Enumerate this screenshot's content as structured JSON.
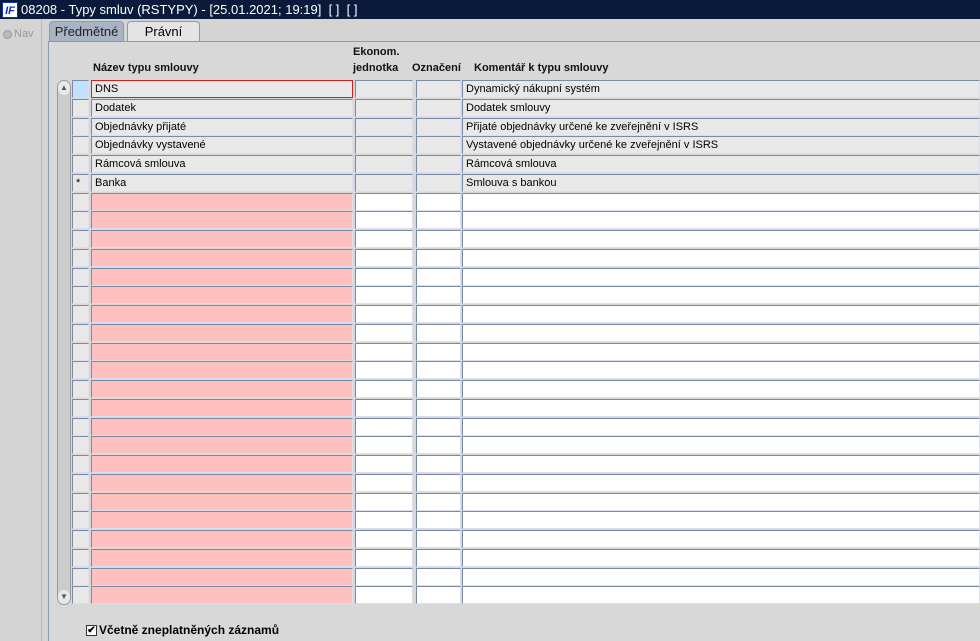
{
  "window": {
    "title": "08208 - Typy smluv (RSTYPY) - [25.01.2021; 19:19]  [ ]  [ ]",
    "logo": "IF"
  },
  "nav": {
    "label": "Nav"
  },
  "tabs": [
    {
      "label": "Předmětné"
    },
    {
      "label": "Právní"
    }
  ],
  "columns": {
    "name": "Název typu smlouvy",
    "unit_line1": "Ekonom.",
    "unit_line2": "jednotka",
    "mark": "Označení",
    "comment": "Komentář k typu smlouvy"
  },
  "rows": [
    {
      "marker": "",
      "name": "DNS",
      "unit": "",
      "mark": "",
      "comment": "Dynamický nákupní systém"
    },
    {
      "marker": "",
      "name": "Dodatek",
      "unit": "",
      "mark": "",
      "comment": "Dodatek smlouvy"
    },
    {
      "marker": "",
      "name": "Objednávky přijaté",
      "unit": "",
      "mark": "",
      "comment": "Přijaté objednávky určené ke zveřejnění v ISRS"
    },
    {
      "marker": "",
      "name": "Objednávky vystavené",
      "unit": "",
      "mark": "",
      "comment": "Vystavené objednávky určené ke zveřejnění v ISRS"
    },
    {
      "marker": "",
      "name": "Rámcová smlouva",
      "unit": "",
      "mark": "",
      "comment": "Rámcová smlouva"
    },
    {
      "marker": "*",
      "name": "Banka",
      "unit": "",
      "mark": "",
      "comment": "Smlouva s bankou"
    }
  ],
  "empty_rows": 22,
  "footer": {
    "include_invalid_label": "Včetně zneplatněných záznamů",
    "include_invalid_checked": true
  }
}
